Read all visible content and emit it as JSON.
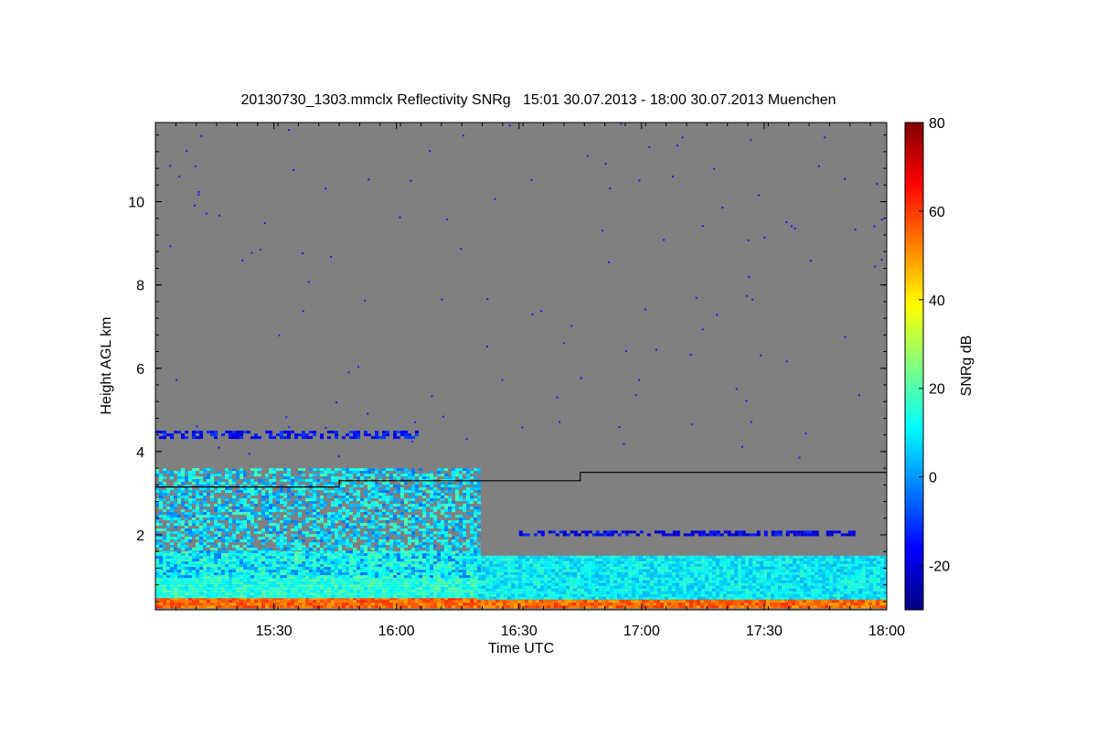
{
  "chart_data": {
    "type": "heatmap",
    "title": "20130730_1303.mmclx Reflectivity SNRg   15:01 30.07.2013 - 18:00 30.07.2013 Muenchen",
    "xlabel": "Time UTC",
    "ylabel": "Height AGL km",
    "x_ticks": [
      "15:30",
      "16:00",
      "16:30",
      "17:00",
      "17:30",
      "18:00"
    ],
    "y_ticks": [
      2,
      4,
      6,
      8,
      10
    ],
    "xlim": [
      "15:01",
      "18:00"
    ],
    "ylim": [
      0.2,
      11.9
    ],
    "colorbar": {
      "label": "SNRg dB",
      "range": [
        -30,
        80
      ],
      "ticks": [
        -20,
        0,
        20,
        40,
        60,
        80
      ],
      "colormap": "jet"
    },
    "background_color": "#808080",
    "line": {
      "name": "",
      "color": "#000000",
      "points": [
        [
          "15:01",
          3.15
        ],
        [
          "15:46",
          3.15
        ],
        [
          "15:46",
          3.3
        ],
        [
          "16:45",
          3.3
        ],
        [
          "16:45",
          3.5
        ],
        [
          "18:00",
          3.5
        ]
      ]
    },
    "echo_features": [
      {
        "feature": "surface_band",
        "time_start": "15:01",
        "time_end": "18:00",
        "height_bottom": 0.25,
        "height_top": 0.5,
        "snr_db": 55
      },
      {
        "feature": "boundary_layer",
        "time_start": "15:01",
        "time_end": "16:20",
        "height_bottom": 0.5,
        "height_top": 1.6,
        "snr_db": 15
      },
      {
        "feature": "boundary_layer",
        "time_start": "16:20",
        "time_end": "18:00",
        "height_bottom": 0.5,
        "height_top": 1.5,
        "snr_db": 10
      },
      {
        "feature": "cloud_layer",
        "time_start": "15:01",
        "time_end": "16:20",
        "height_bottom": 1.0,
        "height_top": 3.6,
        "snr_db": 8
      },
      {
        "feature": "aerosol_layer",
        "time_start": "15:01",
        "time_end": "16:05",
        "height_bottom": 4.35,
        "height_top": 4.5,
        "snr_db": -15
      },
      {
        "feature": "aerosol_layer",
        "time_start": "16:30",
        "time_end": "17:52",
        "height_bottom": 2.0,
        "height_top": 2.1,
        "snr_db": -18
      }
    ]
  }
}
